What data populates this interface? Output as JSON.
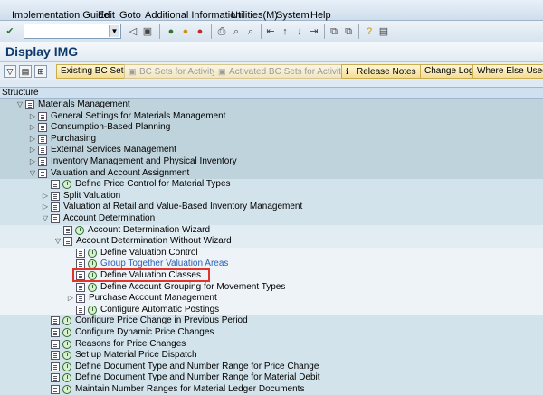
{
  "menu": [
    "Implementation Guide",
    "Edit",
    "Goto",
    "Additional Information",
    "Utilities(M)",
    "System",
    "Help"
  ],
  "title": "Display IMG",
  "appbar": {
    "existing_bc_sets": "Existing BC Sets",
    "bc_sets_for_activity": "BC Sets for Activity",
    "activated_bc_sets": "Activated BC Sets for Activity",
    "release_notes": "Release Notes",
    "change_log": "Change Log",
    "where_else_used": "Where Else Used"
  },
  "tree_header": "Structure",
  "tree": [
    {
      "label": "Materials Management",
      "toggle": "▽",
      "level": 0,
      "exec": false,
      "band": "b0"
    },
    {
      "label": "General Settings for Materials Management",
      "toggle": "▷",
      "level": 1,
      "exec": false,
      "band": "b0"
    },
    {
      "label": "Consumption-Based Planning",
      "toggle": "▷",
      "level": 1,
      "exec": false,
      "band": "b0"
    },
    {
      "label": "Purchasing",
      "toggle": "▷",
      "level": 1,
      "exec": false,
      "band": "b0"
    },
    {
      "label": "External Services Management",
      "toggle": "▷",
      "level": 1,
      "exec": false,
      "band": "b0"
    },
    {
      "label": "Inventory Management and Physical Inventory",
      "toggle": "▷",
      "level": 1,
      "exec": false,
      "band": "b0"
    },
    {
      "label": "Valuation and Account Assignment",
      "toggle": "▽",
      "level": 1,
      "exec": false,
      "band": "b0"
    },
    {
      "label": "Define Price Control for Material Types",
      "toggle": "",
      "level": 2,
      "exec": true,
      "band": "b1"
    },
    {
      "label": "Split Valuation",
      "toggle": "▷",
      "level": 2,
      "exec": false,
      "band": "b1"
    },
    {
      "label": "Valuation at Retail and Value-Based Inventory Management",
      "toggle": "▷",
      "level": 2,
      "exec": false,
      "band": "b1"
    },
    {
      "label": "Account Determination",
      "toggle": "▽",
      "level": 2,
      "exec": false,
      "band": "b1"
    },
    {
      "label": "Account Determination Wizard",
      "toggle": "",
      "level": 3,
      "exec": true,
      "band": "b2"
    },
    {
      "label": "Account Determination Without Wizard",
      "toggle": "▽",
      "level": 3,
      "exec": false,
      "band": "b2"
    },
    {
      "label": "Define Valuation Control",
      "toggle": "",
      "level": 4,
      "exec": true,
      "band": "b3"
    },
    {
      "label": "Group Together Valuation Areas",
      "toggle": "",
      "level": 4,
      "exec": true,
      "band": "b3",
      "link": true
    },
    {
      "label": "Define Valuation Classes",
      "toggle": "",
      "level": 4,
      "exec": true,
      "band": "b3",
      "highlight": true
    },
    {
      "label": "Define Account Grouping for Movement Types",
      "toggle": "",
      "level": 4,
      "exec": true,
      "band": "b3"
    },
    {
      "label": "Purchase Account Management",
      "toggle": "▷",
      "level": 4,
      "exec": false,
      "band": "b3"
    },
    {
      "label": "Configure Automatic Postings",
      "toggle": "",
      "level": 4,
      "exec": true,
      "band": "b3"
    },
    {
      "label": "Configure Price Change in Previous Period",
      "toggle": "",
      "level": 2,
      "exec": true,
      "band": "b1"
    },
    {
      "label": "Configure Dynamic Price Changes",
      "toggle": "",
      "level": 2,
      "exec": true,
      "band": "b1"
    },
    {
      "label": "Reasons for Price Changes",
      "toggle": "",
      "level": 2,
      "exec": true,
      "band": "b1"
    },
    {
      "label": "Set up Material Price Dispatch",
      "toggle": "",
      "level": 2,
      "exec": true,
      "band": "b1"
    },
    {
      "label": "Define Document Type and Number Range for Price Change",
      "toggle": "",
      "level": 2,
      "exec": true,
      "band": "b1"
    },
    {
      "label": "Define Document Type and Number Range for Material Debit",
      "toggle": "",
      "level": 2,
      "exec": true,
      "band": "b1"
    },
    {
      "label": "Maintain Number Ranges for Material Ledger Documents",
      "toggle": "",
      "level": 2,
      "exec": true,
      "band": "b1"
    }
  ]
}
